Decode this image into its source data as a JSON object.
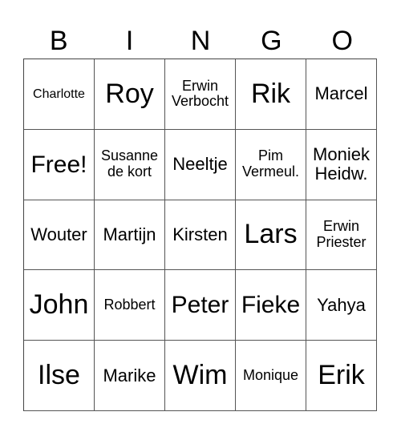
{
  "header": [
    "B",
    "I",
    "N",
    "G",
    "O"
  ],
  "cells": [
    {
      "text": "Charlotte",
      "size": "xs"
    },
    {
      "text": "Roy",
      "size": "xl"
    },
    {
      "text": "Erwin\nVerbocht",
      "size": "s"
    },
    {
      "text": "Rik",
      "size": "xl"
    },
    {
      "text": "Marcel",
      "size": "m"
    },
    {
      "text": "Free!",
      "size": "l"
    },
    {
      "text": "Susanne\nde kort",
      "size": "s"
    },
    {
      "text": "Neeltje",
      "size": "m"
    },
    {
      "text": "Pim\nVermeul.",
      "size": "s"
    },
    {
      "text": "Moniek\nHeidw.",
      "size": "m"
    },
    {
      "text": "Wouter",
      "size": "m"
    },
    {
      "text": "Martijn",
      "size": "m"
    },
    {
      "text": "Kirsten",
      "size": "m"
    },
    {
      "text": "Lars",
      "size": "xl"
    },
    {
      "text": "Erwin\nPriester",
      "size": "s"
    },
    {
      "text": "John",
      "size": "xl"
    },
    {
      "text": "Robbert",
      "size": "s"
    },
    {
      "text": "Peter",
      "size": "l"
    },
    {
      "text": "Fieke",
      "size": "l"
    },
    {
      "text": "Yahya",
      "size": "m"
    },
    {
      "text": "Ilse",
      "size": "xl"
    },
    {
      "text": "Marike",
      "size": "m"
    },
    {
      "text": "Wim",
      "size": "xl"
    },
    {
      "text": "Monique",
      "size": "s"
    },
    {
      "text": "Erik",
      "size": "xl"
    }
  ]
}
